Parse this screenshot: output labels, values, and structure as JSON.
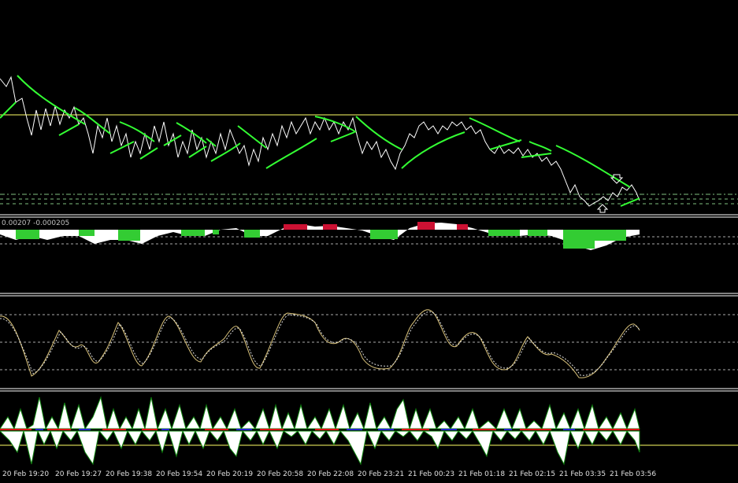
{
  "colors": {
    "background": "#000000",
    "price": "#ffffff",
    "trend_line": "#33ff33",
    "level_line": "#ffff66",
    "dashed_level": "#7fbf7f",
    "separator": "#ffffff",
    "histogram_green": "#33cc33",
    "histogram_red": "#cc1133",
    "histogram_white": "#ffffff",
    "oscillator_line": "#d9c27a",
    "oscillator_signal": "#e0e0e0",
    "volume_green": "#118811",
    "volume_blue": "#2222cc",
    "volume_red": "#dd1111"
  },
  "indicator_panel": {
    "label": "0.00207 -0.000205"
  },
  "markers": {
    "down_arrow_icon": "down-arrow",
    "up_arrow_icon": "up-arrow"
  },
  "time_axis": [
    "20 Feb 19:20",
    "20 Feb 19:27",
    "20 Feb 19:38",
    "20 Feb 19:54",
    "20 Feb 20:19",
    "20 Feb 20:58",
    "20 Feb 22:08",
    "20 Feb 23:21",
    "21 Feb 00:23",
    "21 Feb 01:18",
    "21 Feb 02:15",
    "21 Feb 03:35",
    "21 Feb 03:56"
  ]
}
